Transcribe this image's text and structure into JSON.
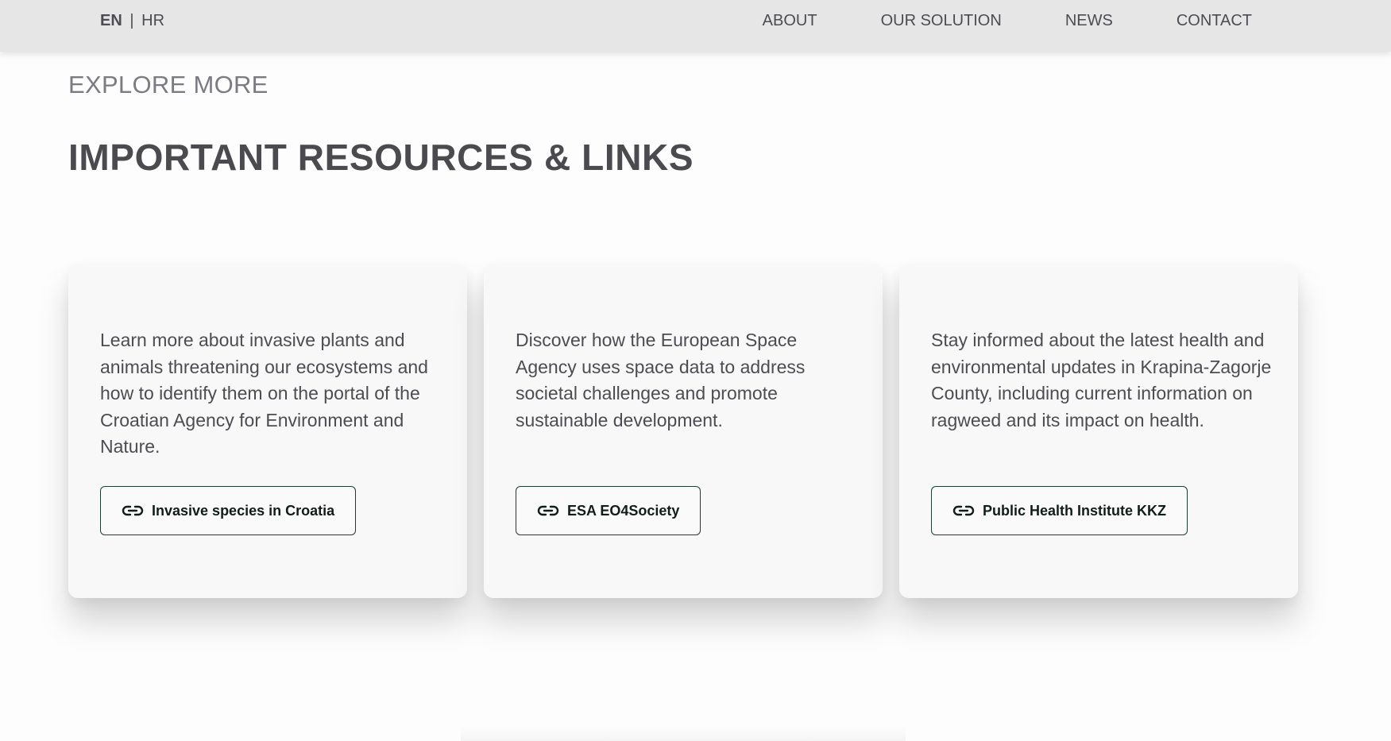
{
  "header": {
    "lang_active": "EN",
    "lang_separator": "|",
    "lang_other": "HR",
    "nav": [
      {
        "label": "ABOUT"
      },
      {
        "label": "OUR SOLUTION"
      },
      {
        "label": "NEWS"
      },
      {
        "label": "CONTACT"
      }
    ]
  },
  "section": {
    "eyebrow": "EXPLORE MORE",
    "title": "IMPORTANT RESOURCES & LINKS"
  },
  "cards": [
    {
      "text": "Learn more about invasive plants and animals threatening our ecosystems and how to identify them on the portal of the Croatian Agency for Environment and Nature.",
      "link_label": "Invasive species in Croatia",
      "icon": "link-icon"
    },
    {
      "text": "Discover how the European Space Agency uses space data to address societal challenges and promote sustainable development.",
      "link_label": "ESA EO4Society",
      "icon": "link-icon"
    },
    {
      "text": "Stay informed about the latest health and environmental updates in Krapina-Zagorje County, including current information on ragweed and its impact on health.",
      "link_label": "Public Health Institute KKZ",
      "icon": "link-icon"
    }
  ],
  "colors": {
    "header_bg": "#e6e6e6",
    "text": "#4c4c52",
    "button_border": "#1e3d35",
    "card_bg": "#f8f8f8"
  }
}
